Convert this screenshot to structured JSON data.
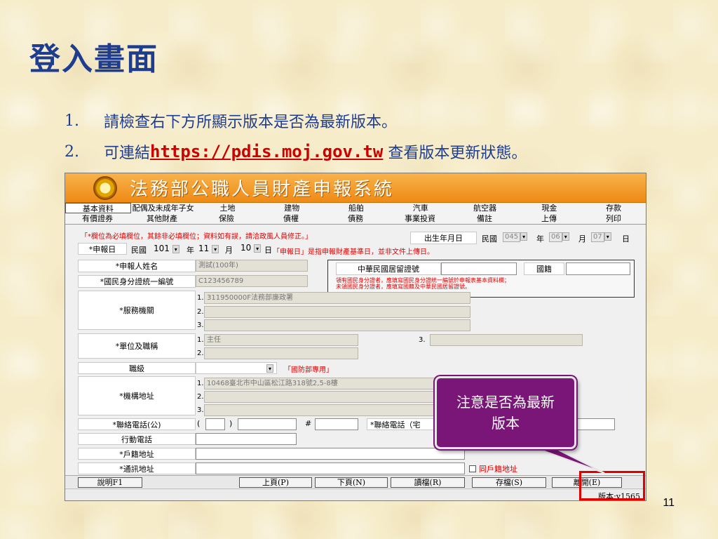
{
  "slide": {
    "title": "登入畫面",
    "bullet1_num": "1.",
    "bullet1_text": "請檢查右下方所顯示版本是否為最新版本。",
    "bullet2_num": "2.",
    "bullet2_prefix": "可連結",
    "bullet2_link": "https://pdis.moj.gov.tw",
    "bullet2_suffix": " 查看版本更新狀態。",
    "page_number": "11"
  },
  "app": {
    "banner_title": "法務部公職人員財產申報系統",
    "tabs_row1": [
      "基本資料",
      "配偶及未成年子女",
      "土地",
      "建物",
      "船舶",
      "汽車",
      "航空器",
      "現金",
      "存款"
    ],
    "tabs_row2": [
      "有價證券",
      "其他財產",
      "保險",
      "債權",
      "債務",
      "事業投資",
      "備註",
      "上傳",
      "列印"
    ],
    "notice": "「*欄位為必填欄位，其餘非必填欄位；資料如有誤，請洽政風人員修正。」",
    "birth_label": "出生年月日",
    "roc_label": "民國",
    "birth_year": "045",
    "year_label": "年",
    "birth_month": "06",
    "month_label": "月",
    "birth_day": "07",
    "day_label": "日",
    "report_date_label": "*申報日",
    "report_roc": "民國",
    "report_year": "101",
    "report_month": "11",
    "report_day": "10",
    "report_note": "「申報日」是指申報財產基準日，並非文件上傳日。",
    "name_label": "*申報人姓名",
    "name_value": "測試(100年)",
    "id_label": "*國民身分證統一編號",
    "id_value": "C123456789",
    "residence_label": "中華民國居留證號",
    "nationality_label": "國籍",
    "residence_note1": "領有國民身分證者，應填寫國民身分證統一編號於申報表基本資料欄；",
    "residence_note2": "未領國民身分證者，應填寫國籍及中華民國居留證號。",
    "agency_label": "*服務機關",
    "agency_value": "311950000F法務部廉政署",
    "idx1": "1.",
    "idx2": "2.",
    "idx3": "3.",
    "position_label": "*單位及職稱",
    "position_value": "主任",
    "rank_label": "職級",
    "defense_note": "「國防部專用」",
    "address_label": "*機構地址",
    "address_value": "10468臺北市中山區松江路318號2,5-8樓",
    "office_phone_label": "*聯絡電話(公)",
    "paren_open": "(",
    "paren_close": ")",
    "hash": "#",
    "home_phone_label": "*聯絡電話（宅",
    "mobile_label": "行動電話",
    "household_label": "*戶籍地址",
    "mailing_label": "*通訊地址",
    "same_as_household": "同戶籍地址",
    "buttons": {
      "help": "說明F1",
      "prev": "上頁(P)",
      "next": "下頁(N)",
      "read": "讀檔(R)",
      "save": "存檔(S)",
      "exit": "離開(E)"
    },
    "version": "版本:v1565"
  },
  "callout": {
    "text": "注意是否為最新版本"
  },
  "colors": {
    "title_blue": "#1f3d8f",
    "link_red": "#cc0000",
    "callout_purple": "#7a1678",
    "highlight_red": "#e00000",
    "banner_orange": "#ef8a15"
  }
}
